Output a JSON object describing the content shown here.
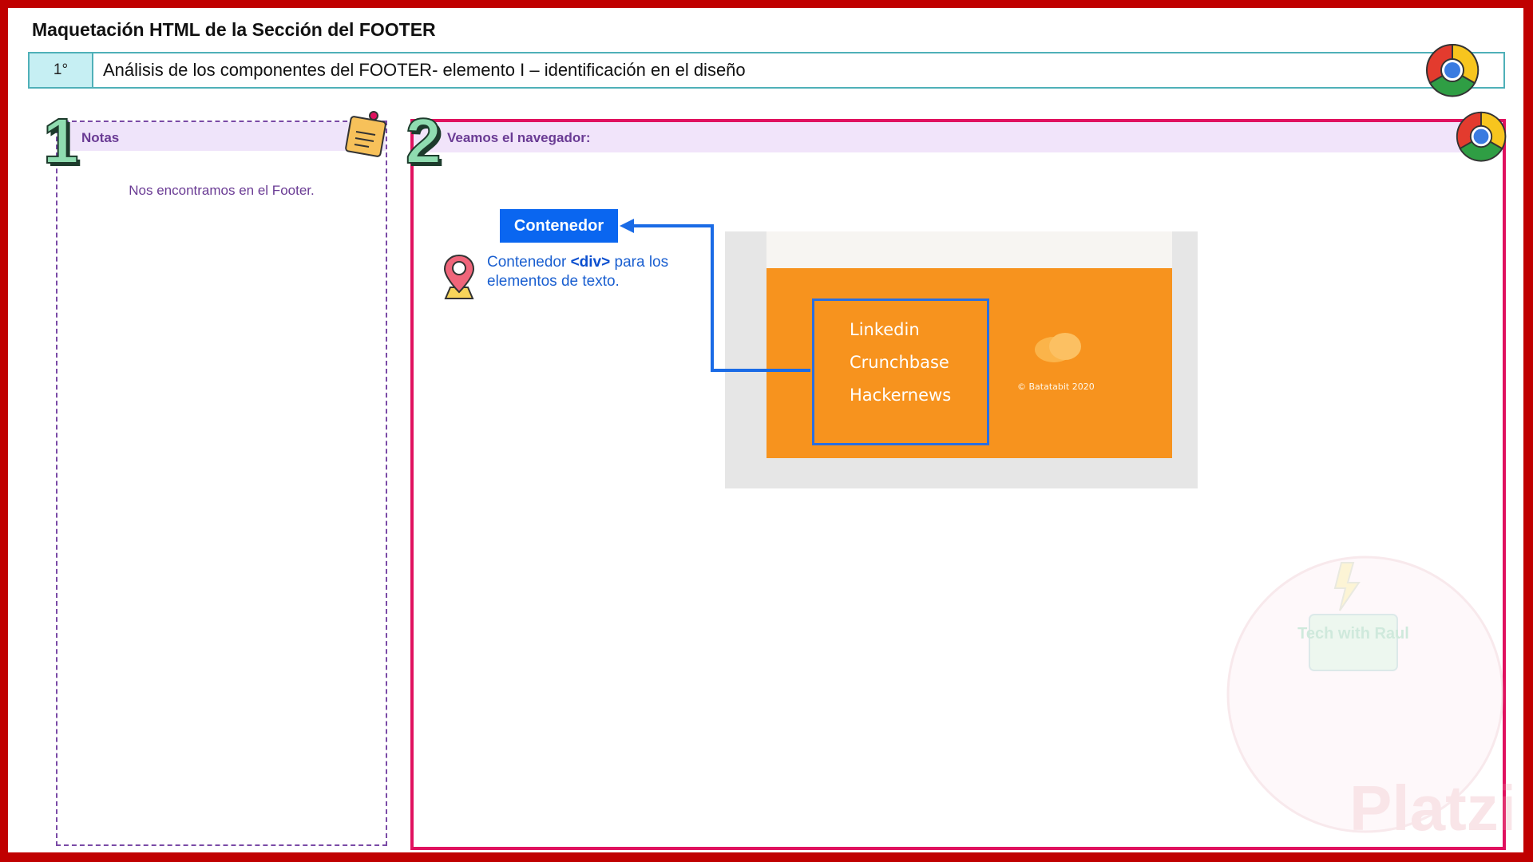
{
  "page": {
    "title": "Maquetación HTML de la Sección del FOOTER",
    "step": {
      "number": "1°",
      "text": "Análisis de los componentes del FOOTER- elemento I – identificación en el diseño"
    }
  },
  "notes": {
    "badge": "1",
    "title": "Notas",
    "text": "Nos encontramos en el Footer."
  },
  "navigator": {
    "badge": "2",
    "title": "Veamos el navegador:",
    "container_label": "Contenedor",
    "description": {
      "prefix": "Contenedor ",
      "tag": "<div>",
      "suffix": " para los elementos de texto."
    }
  },
  "mockup": {
    "links": [
      "Linkedin",
      "Crunchbase",
      "Hackernews"
    ],
    "copyright": "© Batatabit 2020"
  },
  "watermark": {
    "brand": "Platzi",
    "sign": "Tech with Raul"
  },
  "colors": {
    "outer_border": "#c00000",
    "step_border": "#4fb0b8",
    "step_fill": "#c6eff3",
    "notes_border": "#7a4aa6",
    "nav_border": "#e0115f",
    "header_fill": "#efe4fa",
    "accent_blue": "#0a66f0",
    "footer_orange": "#f7931e"
  },
  "icons": [
    "chrome-icon",
    "sticky-note-icon",
    "map-pin-icon",
    "bitcoin-logo-icon"
  ]
}
